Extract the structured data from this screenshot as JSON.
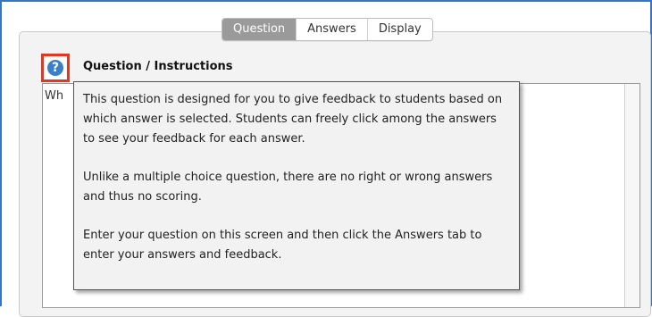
{
  "tabs": [
    {
      "label": "Question",
      "active": true
    },
    {
      "label": "Answers",
      "active": false
    },
    {
      "label": "Display",
      "active": false
    }
  ],
  "help_icon": {
    "glyph": "?",
    "icon": "question-mark-icon"
  },
  "section": {
    "title": "Question / Instructions"
  },
  "editor": {
    "visible_text": "Wh"
  },
  "tooltip": {
    "paragraphs": [
      "This question is designed for you to give feedback to students based on which answer is selected. Students can freely click among the answers to see your feedback for each answer.",
      "Unlike a multiple choice question, there are no right or wrong answers and thus no scoring.",
      "Enter your question on this screen and then click the Answers tab to enter your answers and feedback."
    ]
  },
  "colors": {
    "frame_border": "#3a73bf",
    "highlight_border": "#e03822",
    "help_icon_bg": "#3b80c7",
    "active_tab_bg": "#9a9a9a"
  }
}
